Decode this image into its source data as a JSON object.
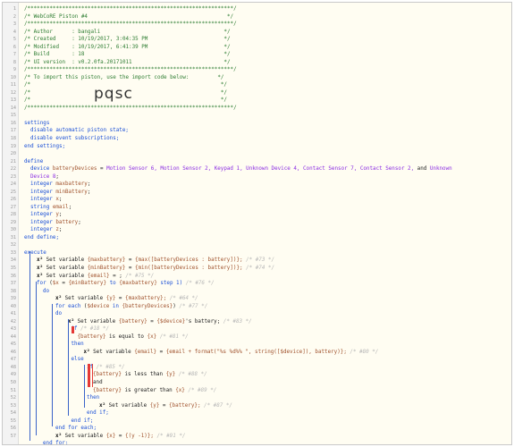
{
  "header_block": {
    "l1": "/*****************************************************************/",
    "title": "/* WebCoRE Piston #4                                            */",
    "l3": "/*****************************************************************/",
    "author": "/* Author      : bangali                                       */",
    "created": "/* Created     : 10/19/2017, 3:04:35 PM                        */",
    "modified": "/* Modified    : 10/19/2017, 6:41:39 PM                        */",
    "build": "/* Build       : 18                                            */",
    "version": "/* UI version  : v0.2.0fa.20171011                             */",
    "l9": "/*****************************************************************/",
    "import_note": "/* To import this piston, use the import code below:         */",
    "blank1": "/*                                                            */",
    "blank2": "/*                                                            */",
    "blank3": "/*                                                            */",
    "l14": "/*****************************************************************/"
  },
  "import_code": "pqsc",
  "settings": {
    "kw_settings": "settings",
    "line1": "disable automatic piston state;",
    "line2": "disable event subscriptions;",
    "end": "end settings;"
  },
  "define": {
    "kw_define": "define",
    "device_kw": "device",
    "device_var": "batteryDevices",
    "devices_eq": " = ",
    "devices_a": "Motion Sensor 6, Motion Sensor 2, Keypad 1, Unknown Device 4, Contact Sensor 7, Contact Sensor 2,",
    "devices_and": " and ",
    "devices_b": "Unknown",
    "devices_c": "Device 8",
    "semi": ";",
    "vars": [
      {
        "type": "integer",
        "name": "maxbattery"
      },
      {
        "type": "integer",
        "name": "minBattery"
      },
      {
        "type": "integer",
        "name": "x"
      },
      {
        "type": "string",
        "name": "email"
      },
      {
        "type": "integer",
        "name": "y"
      },
      {
        "type": "integer",
        "name": "battery"
      },
      {
        "type": "integer",
        "name": "z"
      }
    ],
    "end": "end define;"
  },
  "execute": {
    "kw_execute": "execute",
    "set_icon": "x²",
    "set_max": {
      "prefix": " Set variable ",
      "var": "{maxbattery}",
      "eq": " = ",
      "expr": "{max([batteryDevices : battery])};",
      "id": "/* #73 */"
    },
    "set_min": {
      "prefix": " Set variable ",
      "var": "{minBattery}",
      "eq": " = ",
      "expr": "{min([batteryDevices : battery])};",
      "id": "/* #74 */"
    },
    "set_email": {
      "prefix": " Set variable ",
      "var": "{email}",
      "eq": " = ;",
      "id": "/* #75 */"
    },
    "for_line": {
      "kw": "for ",
      "open": "(",
      "var": "$x",
      "eq": " = ",
      "from": "{minBattery}",
      "to_kw": " to ",
      "to": "{maxbattery}",
      "step": " step 1)",
      "id": "/* #76 */"
    },
    "do1": "do",
    "set_y": {
      "prefix": " Set variable ",
      "var": "{y}",
      "eq": " = ",
      "expr": "{maxbattery};",
      "id": "/* #64 */"
    },
    "foreach": {
      "kw": "for each ",
      "open": "(",
      "var": "$device",
      "in": " in ",
      "col": "{batteryDevices}",
      "close": ")",
      "id": "/* #77 */"
    },
    "do2": "do",
    "set_battery": {
      "prefix": " Set variable ",
      "var": "{battery}",
      "eq": " = ",
      "expr": "{$device}",
      "suffix": "'s battery;",
      "id": "/* #83 */"
    },
    "if1": {
      "kw": "if",
      "id": "/* #18 */"
    },
    "cond1": {
      "var": "{battery}",
      "op": " is equal to ",
      "val": "{x}",
      "id": "/* #81 */"
    },
    "then1": "then",
    "set_email2": {
      "prefix": " Set variable ",
      "var": "{email}",
      "eq": " = ",
      "expr": "{email + format(\"%s %d%% \", string([$device]), battery)};",
      "id": "/* #80 */"
    },
    "else1": "else",
    "if2": {
      "kw": "if",
      "id": "/* #85 */"
    },
    "cond2": {
      "var": "{battery}",
      "op": " is less than ",
      "val": "{y}",
      "id": "/* #88 */"
    },
    "and_kw": "and",
    "cond3": {
      "var": "{battery}",
      "op": " is greater than ",
      "val": "{x}",
      "id": "/* #89 */"
    },
    "then2": "then",
    "set_y2": {
      "prefix": " Set variable ",
      "var": "{y}",
      "eq": " = ",
      "expr": "{battery};",
      "id": "/* #87 */"
    },
    "endif1": "end if;",
    "endif2": "end if;",
    "endforeach": "end for each;",
    "set_x": {
      "prefix": " Set variable ",
      "var": "{x}",
      "eq": " = ",
      "expr": "{(y -1)};",
      "id": "/* #91 */"
    },
    "endfor": "end for;",
    "end": "end execute;"
  },
  "line_numbers": [
    "1",
    "2",
    "3",
    "4",
    "5",
    "6",
    "7",
    "8",
    "9",
    "10",
    "11",
    "12",
    "13",
    "14",
    "15",
    "16",
    "17",
    "18",
    "19",
    "20",
    "21",
    "22",
    "23",
    "24",
    "25",
    "26",
    "27",
    "28",
    "29",
    "30",
    "31",
    "32",
    "33",
    "34",
    "35",
    "36",
    "37",
    "38",
    "39",
    "40",
    "41",
    "42",
    "43",
    "44",
    "45",
    "46",
    "47",
    "48",
    "49",
    "50",
    "51",
    "52",
    "53",
    "54",
    "55",
    "56",
    "57"
  ]
}
